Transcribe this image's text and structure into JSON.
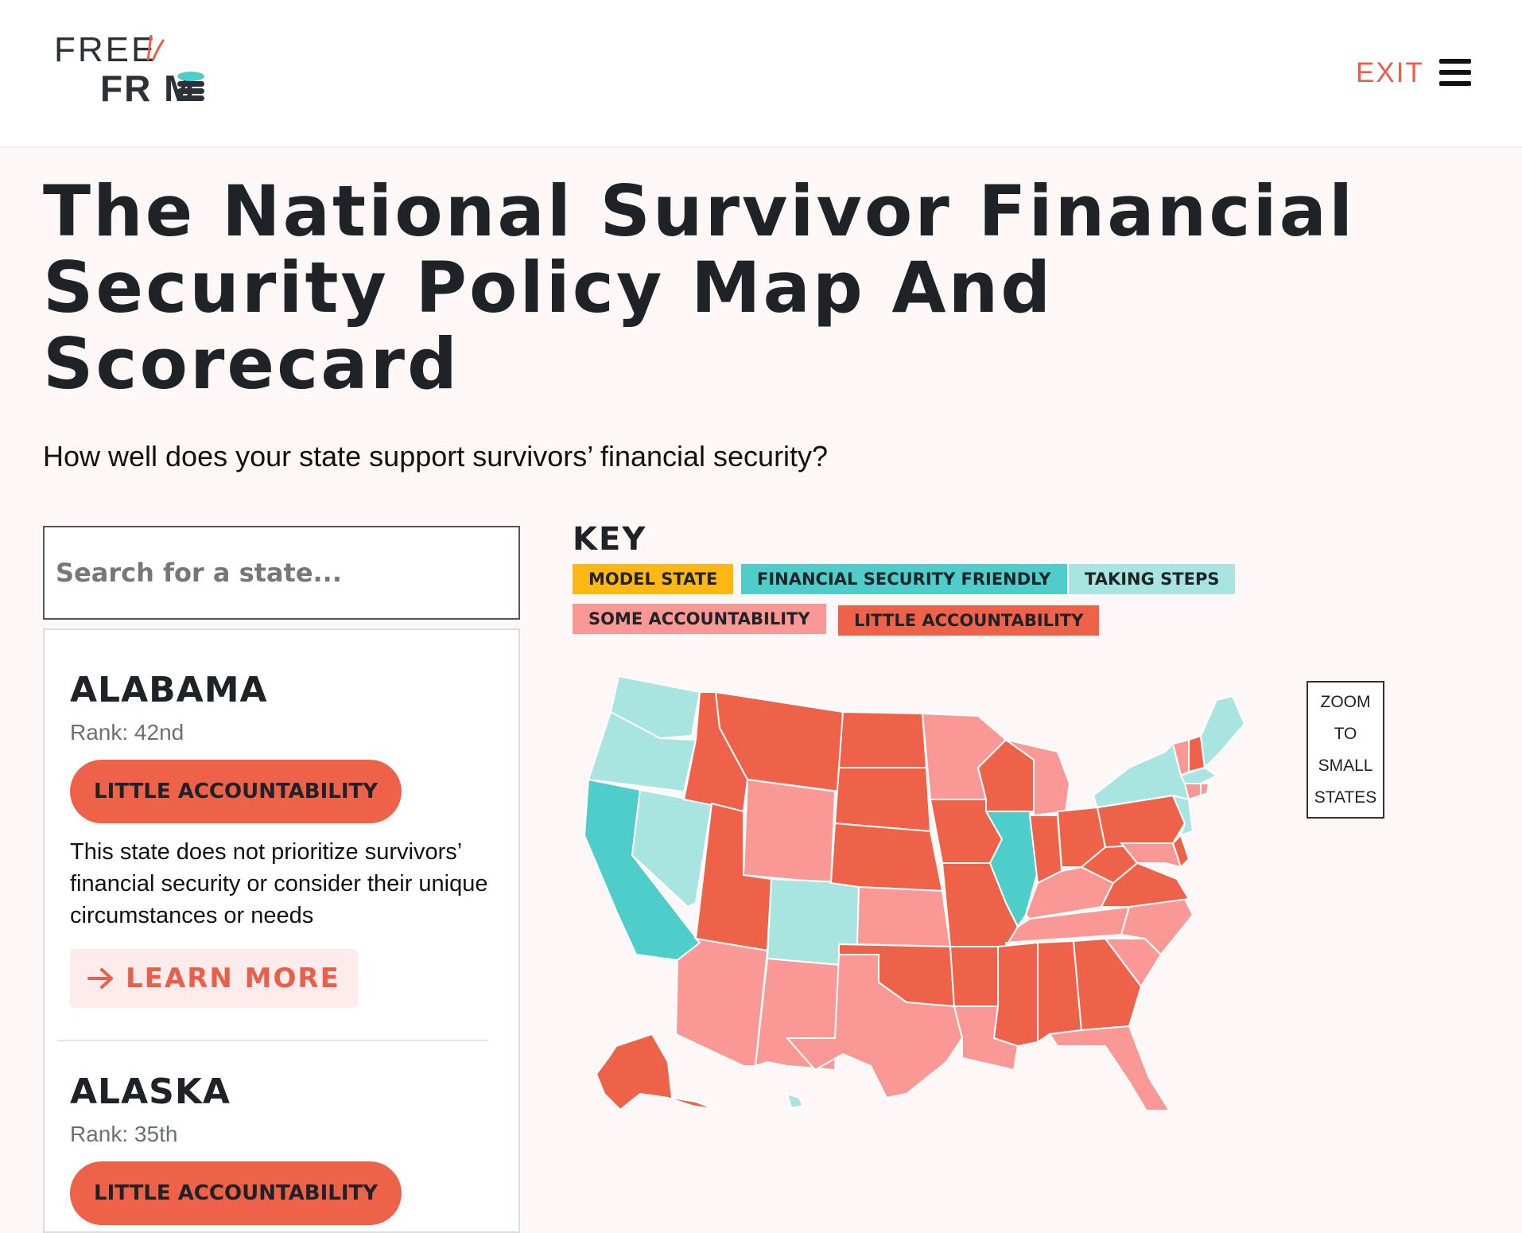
{
  "header": {
    "logo_top": "FREE",
    "logo_bottom": "FR M",
    "exit_label": "EXIT"
  },
  "page": {
    "title": "The National Survivor Financial Security Policy Map And Scorecard",
    "subtitle": "How well does your state support survivors’ financial security?"
  },
  "search": {
    "placeholder": "Search for a state..."
  },
  "states": [
    {
      "name": "ALABAMA",
      "rank": "Rank: 42nd",
      "category": "LITTLE ACCOUNTABILITY",
      "description": "This state does not prioritize survivors’ financial security or consider their unique circumstances or needs",
      "learn_more": "LEARN MORE"
    },
    {
      "name": "ALASKA",
      "rank": "Rank: 35th",
      "category": "LITTLE ACCOUNTABILITY"
    }
  ],
  "key": {
    "title": "KEY",
    "items": [
      {
        "label": "MODEL STATE",
        "color": "#fdb813"
      },
      {
        "label": "FINANCIAL SECURITY FRIENDLY",
        "color": "#4ecdcb"
      },
      {
        "label": "TAKING STEPS",
        "color": "#a8e4e0"
      },
      {
        "label": "SOME ACCOUNTABILITY",
        "color": "#fa9896"
      },
      {
        "label": "LITTLE ACCOUNTABILITY",
        "color": "#ef624a"
      }
    ]
  },
  "zoom": {
    "line1": "ZOOM",
    "line2": "TO",
    "line3": "SMALL",
    "line4": "STATES"
  },
  "map_colors": {
    "little": "#ef624a",
    "some": "#fa9896",
    "steps": "#a8e4e0",
    "friendly": "#4ecdcb"
  }
}
